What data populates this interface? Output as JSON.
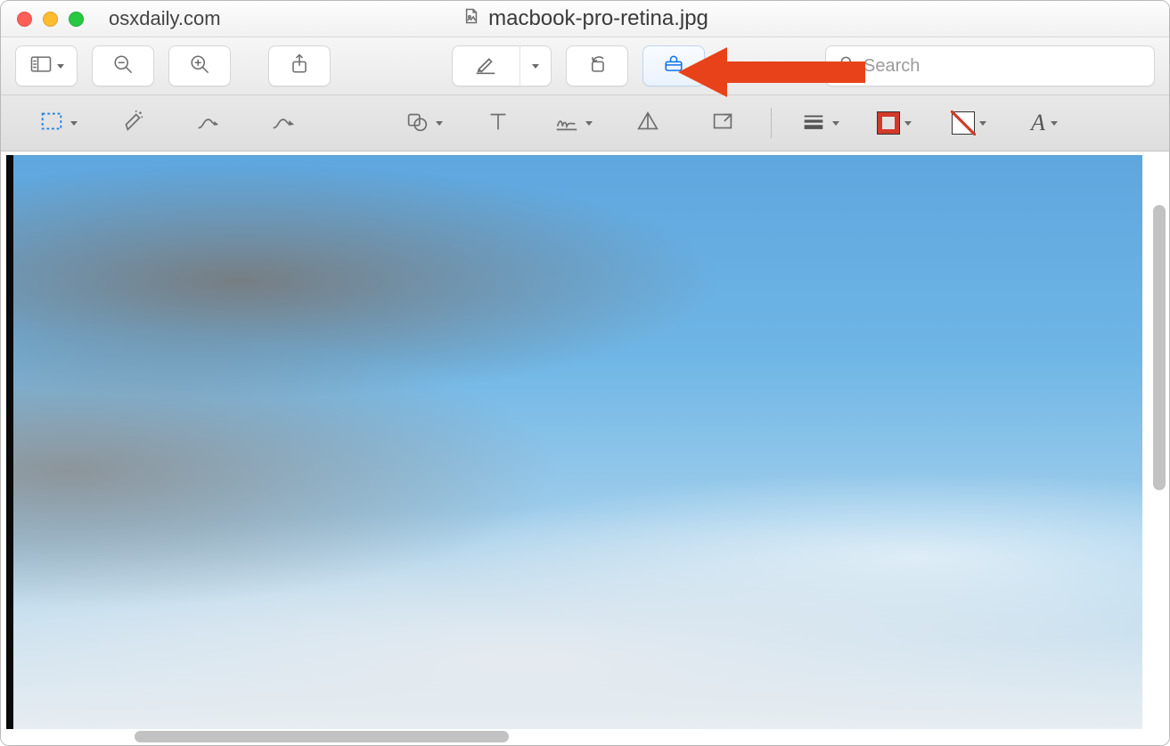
{
  "titlebar": {
    "site": "osxdaily.com",
    "filename": "macbook-pro-retina.jpg",
    "doc_icon": "image-doc-icon"
  },
  "toolbar": {
    "sidebar": {
      "icon": "sidebar-icon"
    },
    "zoom_out": {
      "icon": "zoom-out-icon"
    },
    "zoom_in": {
      "icon": "zoom-in-icon"
    },
    "share": {
      "icon": "share-icon"
    },
    "highlight": {
      "icon": "highlight-icon"
    },
    "rotate": {
      "icon": "rotate-left-icon"
    },
    "markup": {
      "icon": "markup-toolbox-icon",
      "active": true
    },
    "search": {
      "icon": "search-icon",
      "placeholder": "Search",
      "value": ""
    }
  },
  "markup": {
    "selection": {
      "icon": "rect-select-icon"
    },
    "instant_alpha": {
      "icon": "instant-alpha-icon"
    },
    "draw": {
      "icon": "draw-icon"
    },
    "sketch": {
      "icon": "sketch-icon"
    },
    "shapes": {
      "icon": "shapes-icon"
    },
    "text": {
      "icon": "text-icon"
    },
    "sign": {
      "icon": "sign-icon"
    },
    "adjust_color": {
      "icon": "adjust-color-icon"
    },
    "adjust_size": {
      "icon": "adjust-size-icon"
    },
    "line_style": {
      "icon": "line-style-icon"
    },
    "border_color": {
      "icon": "border-color-swatch",
      "color": "#d23a2a"
    },
    "fill_color": {
      "icon": "fill-color-swatch",
      "color": "none"
    },
    "font_style": {
      "icon": "font-style-icon"
    }
  },
  "content": {
    "description": "Cloudy blue sky photo"
  },
  "annotation": {
    "kind": "arrow",
    "color": "#e8421a",
    "points_to": "markup toolbox button"
  }
}
